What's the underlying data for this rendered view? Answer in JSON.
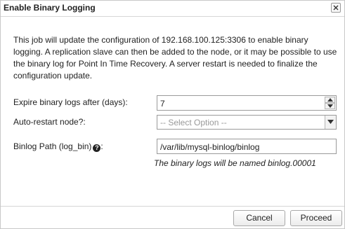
{
  "dialog": {
    "title": "Enable Binary Logging",
    "intro": "This job will update the configuration of 192.168.100.125:3306 to enable binary logging. A replication slave can then be added to the node, or it may be possible to use the binary log for Point In Time Recovery. A server restart is needed to finalize the configuration update."
  },
  "form": {
    "expire": {
      "label": "Expire binary logs after (days):",
      "value": "7"
    },
    "auto_restart": {
      "label": "Auto-restart node?:",
      "selected": "-- Select Option --"
    },
    "binlog_path": {
      "label": "Binlog Path (log_bin)",
      "help_icon": "question-circle",
      "value": "/var/lib/mysql-binlog/binlog"
    },
    "hint": "The binary logs will be named binlog.00001"
  },
  "buttons": {
    "cancel": "Cancel",
    "proceed": "Proceed"
  }
}
